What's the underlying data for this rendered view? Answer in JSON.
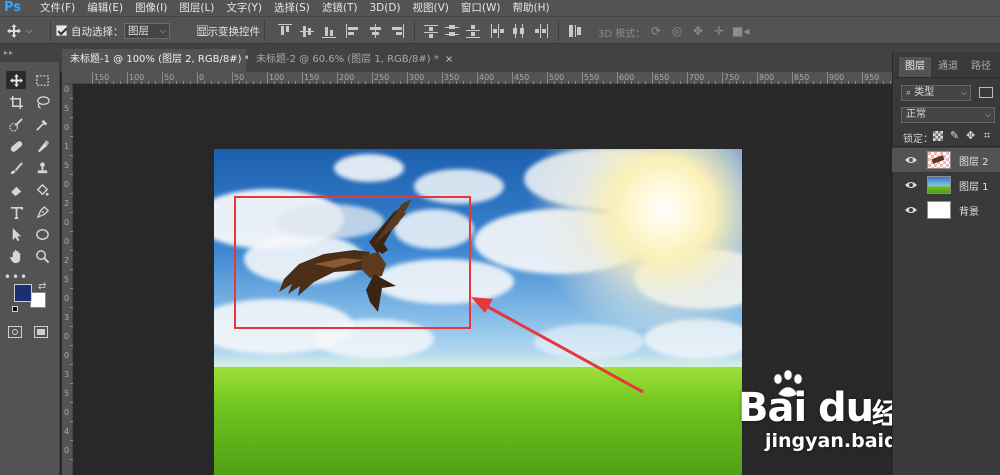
{
  "app": {
    "logo_text": "Ps",
    "menus": [
      "文件(F)",
      "编辑(E)",
      "图像(I)",
      "图层(L)",
      "文字(Y)",
      "选择(S)",
      "滤镜(T)",
      "3D(D)",
      "视图(V)",
      "窗口(W)",
      "帮助(H)"
    ]
  },
  "options_bar": {
    "auto_select_label": "自动选择：",
    "auto_select_checked": true,
    "auto_select_value": "图层",
    "transform_controls_label": "显示变换控件",
    "transform_controls_checked": false,
    "mode_3d_label": "3D 模式："
  },
  "tabs": [
    {
      "label": "未标题-1 @ 100% (图层 2, RGB/8#) *",
      "close": "×",
      "active": true
    },
    {
      "label": "未标题-2 @ 60.6% (图层 1, RGB/8#) *",
      "close": "×",
      "active": false
    }
  ],
  "ruler": {
    "h_labels": [
      "150",
      "100",
      "50",
      "0",
      "50",
      "100",
      "150",
      "200",
      "250",
      "300",
      "350",
      "400",
      "450",
      "500",
      "550",
      "600",
      "650",
      "700",
      "750",
      "800",
      "850",
      "900",
      "950"
    ],
    "v_labels": [
      "0",
      "5",
      "0",
      "1",
      "5",
      "0",
      "2",
      "0",
      "0",
      "2",
      "5",
      "0",
      "3",
      "0",
      "0",
      "3",
      "5",
      "0",
      "4",
      "0"
    ]
  },
  "colors": {
    "foreground": "#1d2f6f",
    "background": "#ffffff",
    "selection_rect": "#e8363a",
    "arrow": "#e8363a"
  },
  "panel": {
    "tabs": [
      "图层",
      "通道",
      "路径"
    ],
    "filter_value": "类型",
    "blend_mode": "正常",
    "lock_label": "锁定：",
    "layers": [
      {
        "name": "图层 2",
        "selected": true,
        "thumb": "transparent-with-eagle"
      },
      {
        "name": "图层 1",
        "selected": false,
        "thumb": "landscape"
      },
      {
        "name": "背景",
        "selected": false,
        "thumb": "white"
      }
    ]
  },
  "watermark": {
    "brand": "Bai",
    "brand2": "du",
    "subtitle": "经验",
    "url": "jingyan.baidu.com"
  }
}
